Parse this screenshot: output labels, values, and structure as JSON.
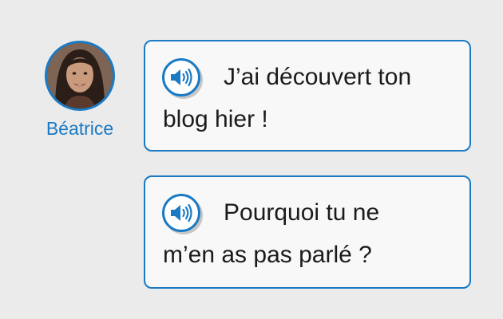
{
  "speaker": {
    "name": "Béatrice",
    "avatar_icon": "portrait-avatar"
  },
  "messages": [
    {
      "audio_icon": "speaker-icon",
      "line1": "J’ai découvert ton",
      "line2": "blog hier !"
    },
    {
      "audio_icon": "speaker-icon",
      "line1": "Pourquoi tu ne",
      "line2": "m’en as pas parlé ?"
    }
  ],
  "colors": {
    "accent": "#1a7ac4",
    "background": "#ebebeb",
    "bubble": "#f8f8f8",
    "text": "#1b1b1b"
  }
}
